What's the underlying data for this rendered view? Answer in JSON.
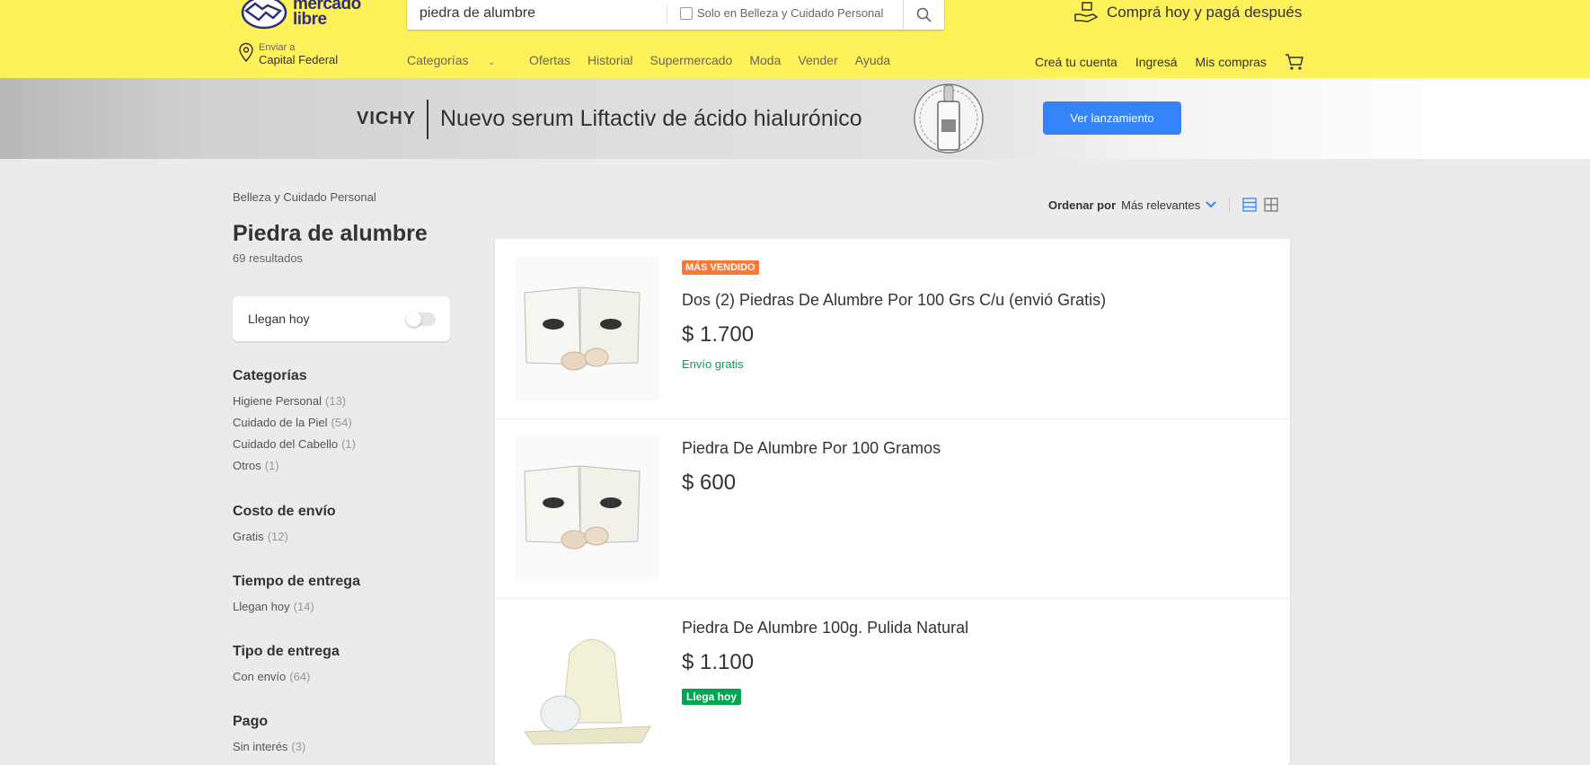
{
  "header": {
    "logo_text_line1": "mercado",
    "logo_text_line2": "libre",
    "search_value": "piedra de alumbre",
    "search_filter_label": "Solo en Belleza y Cuidado Personal",
    "promo_text": "Comprá hoy y pagá después",
    "location_small": "Enviar a",
    "location_big": "Capital Federal",
    "nav": [
      "Categorías",
      "Ofertas",
      "Historial",
      "Supermercado",
      "Moda",
      "Vender",
      "Ayuda"
    ],
    "user_nav": [
      "Creá tu cuenta",
      "Ingresá",
      "Mis compras"
    ],
    "brand_color": "#fff159"
  },
  "banner": {
    "brand": "VICHY",
    "title": "Nuevo serum Liftactiv de ácido hialurónico",
    "button": "Ver lanzamiento",
    "button_color": "#3483fa"
  },
  "sidebar": {
    "breadcrumb": "Belleza y Cuidado Personal",
    "title": "Piedra de alumbre",
    "results": "69 resultados",
    "toggle_label": "Llegan hoy",
    "toggle_on": false,
    "filters": [
      {
        "title": "Categorías",
        "items": [
          {
            "label": "Higiene Personal",
            "count": "(13)"
          },
          {
            "label": "Cuidado de la Piel",
            "count": "(54)"
          },
          {
            "label": "Cuidado del Cabello",
            "count": "(1)"
          },
          {
            "label": "Otros",
            "count": "(1)"
          }
        ]
      },
      {
        "title": "Costo de envío",
        "items": [
          {
            "label": "Gratis",
            "count": "(12)"
          }
        ]
      },
      {
        "title": "Tiempo de entrega",
        "items": [
          {
            "label": "Llegan hoy",
            "count": "(14)"
          }
        ]
      },
      {
        "title": "Tipo de entrega",
        "items": [
          {
            "label": "Con envío",
            "count": "(64)"
          }
        ]
      },
      {
        "title": "Pago",
        "items": [
          {
            "label": "Sin interés",
            "count": "(3)"
          }
        ]
      }
    ]
  },
  "sort": {
    "label": "Ordenar por",
    "value": "Más relevantes"
  },
  "products": [
    {
      "badge": "MÁS VENDIDO",
      "title": "Dos (2) Piedras De Alumbre Por 100 Grs C/u (envió Gratis)",
      "price": "$ 1.700",
      "shipping": "Envío gratis",
      "thumb": "box-icon"
    },
    {
      "title": "Piedra De Alumbre Por 100 Gramos",
      "price": "$ 600",
      "thumb": "box-icon"
    },
    {
      "title": "Piedra De Alumbre 100g. Pulida Natural",
      "price": "$ 1.100",
      "arrives": "Llega hoy",
      "thumb": "bag-icon"
    }
  ]
}
